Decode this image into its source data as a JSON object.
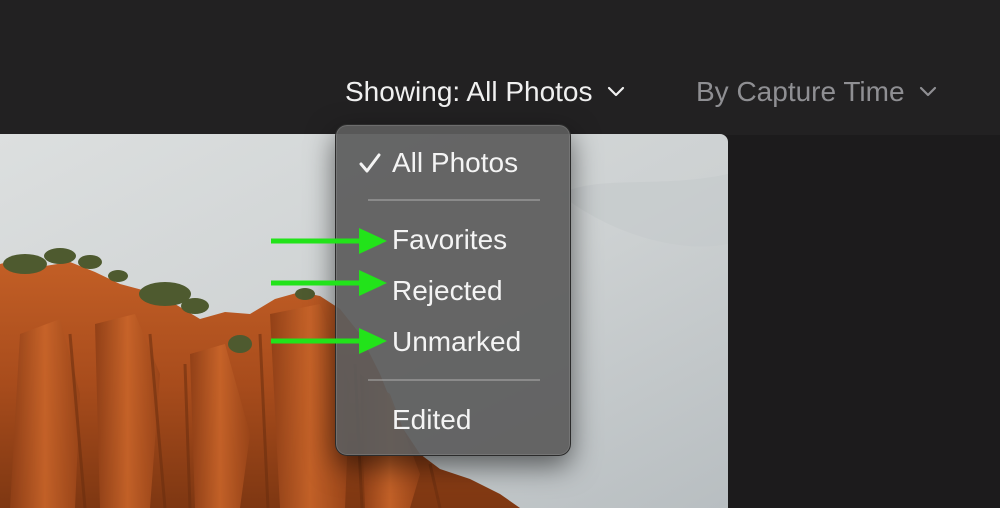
{
  "toolbar": {
    "filter_label": "Showing: All Photos",
    "sort_label": "By Capture Time"
  },
  "filter_menu": {
    "items": [
      {
        "label": "All Photos",
        "checked": true
      },
      {
        "label": "Favorites",
        "checked": false
      },
      {
        "label": "Rejected",
        "checked": false
      },
      {
        "label": "Unmarked",
        "checked": false
      },
      {
        "label": "Edited",
        "checked": false
      }
    ]
  },
  "colors": {
    "background": "#1c1b1c",
    "toolbar": "#222122",
    "menu": "#5c5c5c",
    "annotation_arrow": "#22e31a",
    "sort_text": "#8f8f93"
  },
  "icons": {
    "filter_chevron": "chevron-down-icon",
    "sort_chevron": "chevron-down-icon",
    "selected_marker": "checkmark-icon",
    "annotation": "arrow-right-icon"
  }
}
